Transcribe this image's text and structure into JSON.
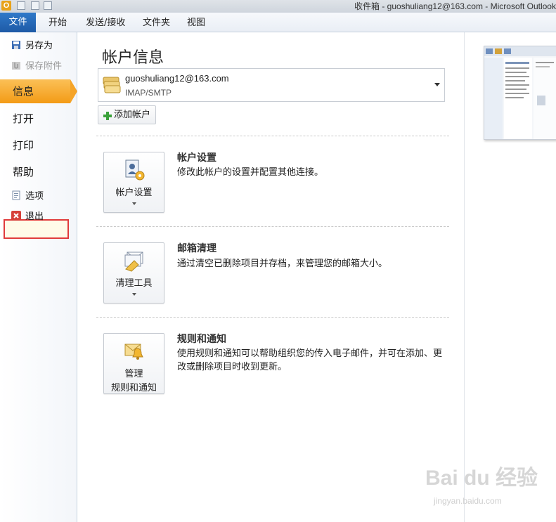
{
  "titlebar": {
    "title": "收件箱 - guoshuliang12@163.com - Microsoft Outlook"
  },
  "tabs": {
    "file": "文件",
    "home": "开始",
    "send_receive": "发送/接收",
    "folder": "文件夹",
    "view": "视图"
  },
  "nav": {
    "save_as": "另存为",
    "save_attachments": "保存附件",
    "info": "信息",
    "open": "打开",
    "print": "打印",
    "help": "帮助",
    "options": "选项",
    "exit": "退出"
  },
  "main": {
    "title": "帐户信息",
    "account": {
      "email": "guoshuliang12@163.com",
      "type": "IMAP/SMTP"
    },
    "add_account": "添加帐户",
    "sections": [
      {
        "tile_label": "帐户设置",
        "title": "帐户设置",
        "desc": "修改此帐户的设置并配置其他连接。"
      },
      {
        "tile_label": "清理工具",
        "title": "邮箱清理",
        "desc": "通过清空已删除项目并存档，来管理您的邮箱大小。"
      },
      {
        "tile_label_1": "管理",
        "tile_label_2": "规则和通知",
        "title": "规则和通知",
        "desc": "使用规则和通知可以帮助组织您的传入电子邮件，并可在添加、更改或删除项目时收到更新。"
      }
    ]
  },
  "watermark": {
    "main": "Bai du 经验",
    "sub": "jingyan.baidu.com"
  }
}
